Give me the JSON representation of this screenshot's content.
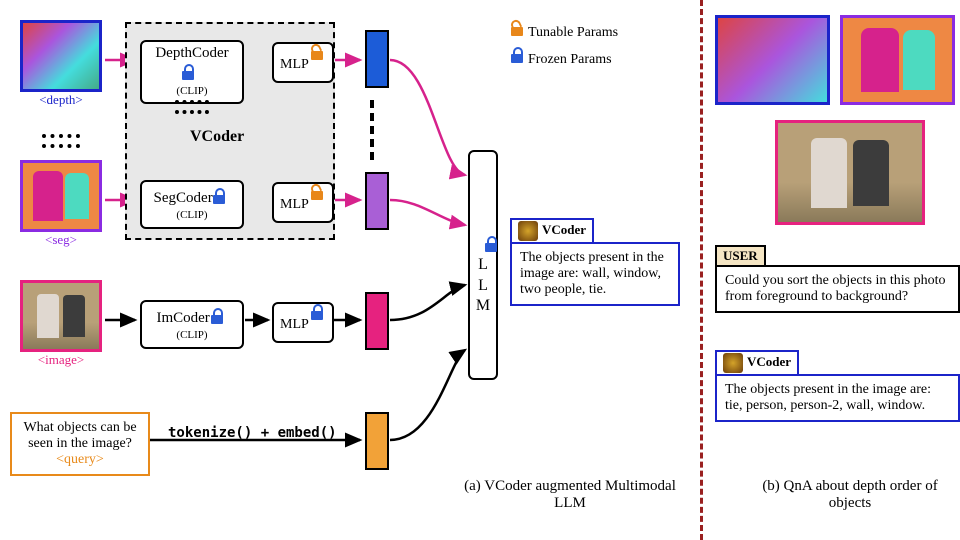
{
  "inputs": {
    "depth_label": "<depth>",
    "seg_label": "<seg>",
    "image_label": "<image>",
    "query_text": "What objects can be seen in the image?",
    "query_label": "<query>"
  },
  "coders": {
    "depth": "DepthCoder",
    "seg": "SegCoder",
    "img": "ImCoder",
    "sub": "(CLIP)",
    "mlp": "MLP",
    "vcoder_label": "VCoder"
  },
  "llm": "L L M",
  "tokenize": "tokenize() + embed()",
  "legend": {
    "tunable": "Tunable Params",
    "frozen": "Frozen Params"
  },
  "chat_a": {
    "vcoder_name": "VCoder",
    "vcoder_text": "The objects present in the image are: wall, window, two people, tie."
  },
  "caption_a": "(a) VCoder augmented Multimodal LLM",
  "chat_b": {
    "user_name": "USER",
    "user_text": "Could you sort the objects in this photo from foreground to background?",
    "vcoder_name": "VCoder",
    "vcoder_text": "The objects present in the image are: tie, person, person-2, wall, window."
  },
  "caption_b": "(b) QnA about depth order of objects"
}
